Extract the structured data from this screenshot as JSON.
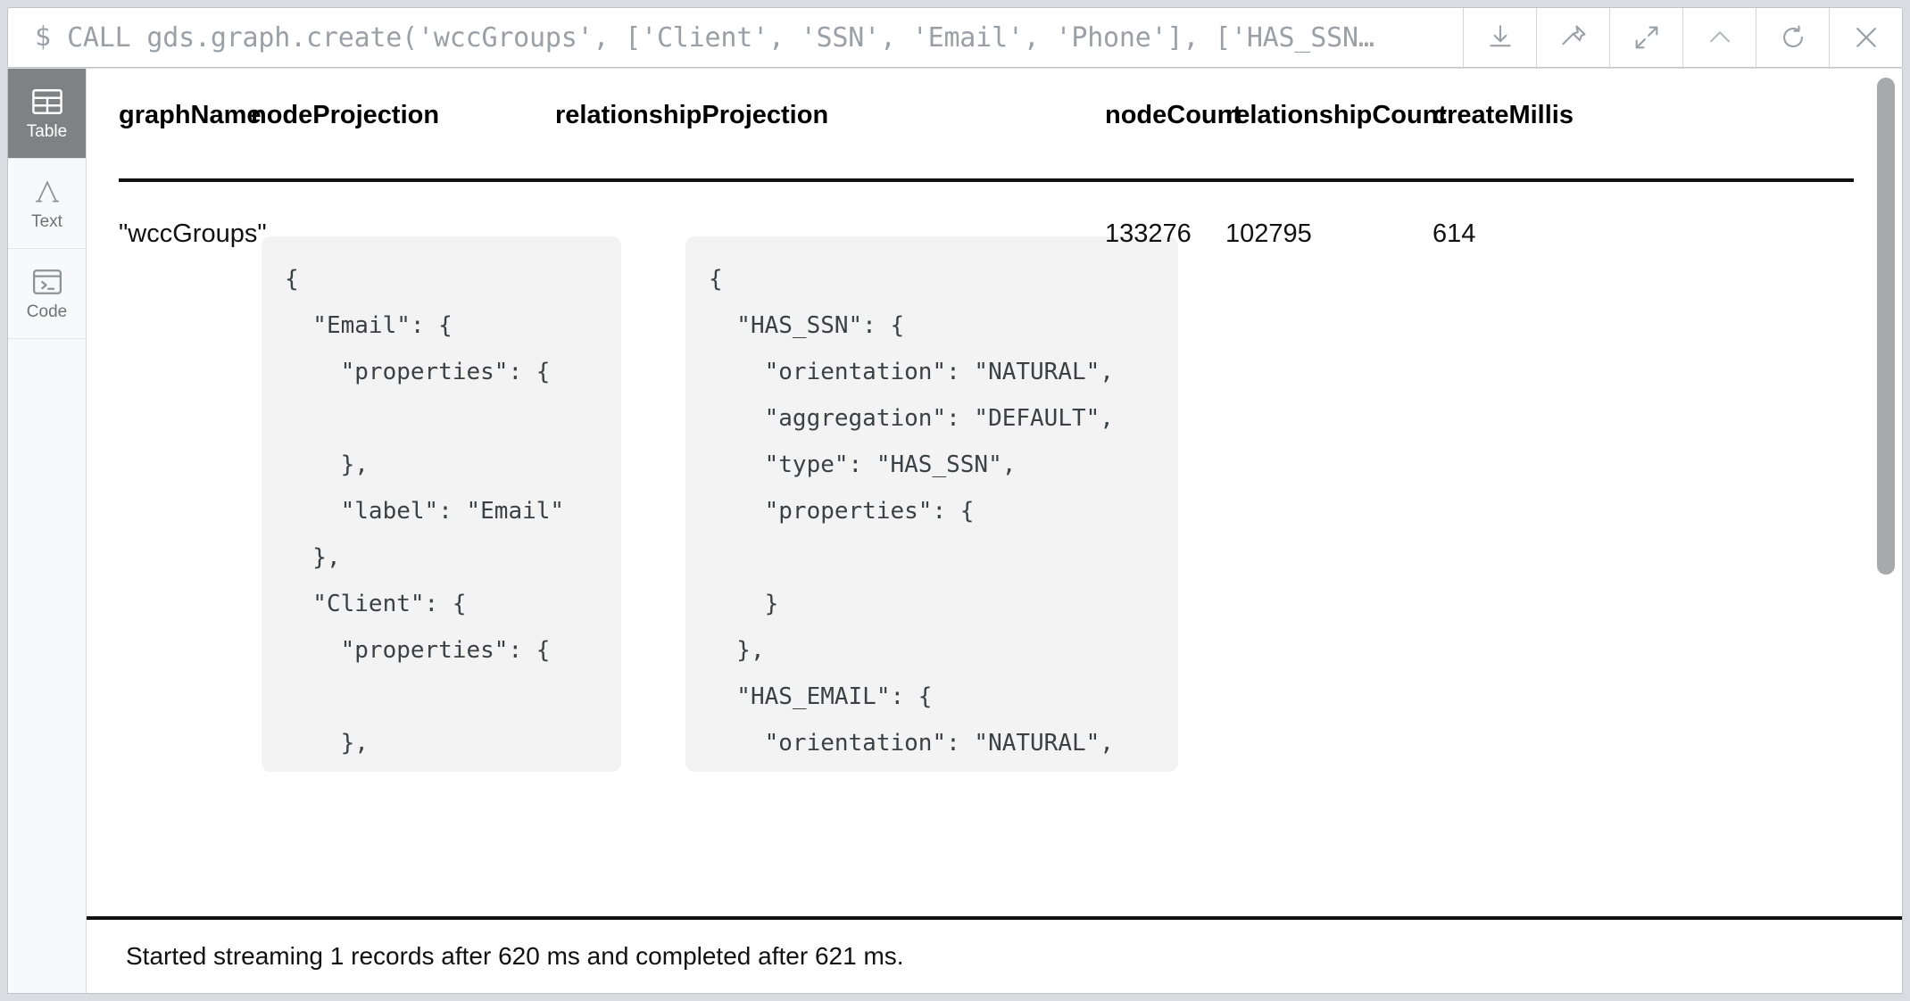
{
  "command_bar": {
    "prompt_symbol": "$",
    "command": "CALL gds.graph.create('wccGroups', ['Client', 'SSN', 'Email', 'Phone'], ['HAS_SSN…",
    "actions": [
      {
        "name": "download-button",
        "icon": "download-icon",
        "label": "Download"
      },
      {
        "name": "pin-button",
        "icon": "pin-icon",
        "label": "Pin"
      },
      {
        "name": "expand-button",
        "icon": "expand-icon",
        "label": "Expand"
      },
      {
        "name": "collapse-button",
        "icon": "chevron-up-icon",
        "label": "Collapse"
      },
      {
        "name": "rerun-button",
        "icon": "refresh-icon",
        "label": "Rerun"
      },
      {
        "name": "close-button",
        "icon": "close-icon",
        "label": "Close"
      }
    ]
  },
  "sidebar": {
    "items": [
      {
        "label": "Table",
        "icon": "table-icon",
        "active": true
      },
      {
        "label": "Text",
        "icon": "text-icon",
        "active": false
      },
      {
        "label": "Code",
        "icon": "code-icon",
        "active": false
      }
    ]
  },
  "table": {
    "columns": [
      "graphName",
      "nodeProjection",
      "relationshipProjection",
      "nodeCount",
      "relationshipCount",
      "createMillis"
    ],
    "row": {
      "graphName": "\"wccGroups\"",
      "nodeProjection": "{\n  \"Email\": {\n    \"properties\": {\n\n    },\n    \"label\": \"Email\"\n  },\n  \"Client\": {\n    \"properties\": {\n\n    },\n    \"label\": \"Client\"\n  },\n  \"Phone\": {\n    \"properties\": {",
      "relationshipProjection": "{\n  \"HAS_SSN\": {\n    \"orientation\": \"NATURAL\",\n    \"aggregation\": \"DEFAULT\",\n    \"type\": \"HAS_SSN\",\n    \"properties\": {\n\n    }\n  },\n  \"HAS_EMAIL\": {\n    \"orientation\": \"NATURAL\",\n    \"aggregation\": \"DEFAULT\",\n    \"type\": \"HAS_EMAIL\",\n    \"properties\": {",
      "nodeCount": "133276",
      "relationshipCount": "102795",
      "createMillis": "614"
    }
  },
  "status": {
    "message": "Started streaming 1 records after 620 ms and completed after 621 ms."
  },
  "colors": {
    "panel_background": "#ffffff",
    "app_background": "#d9dde2",
    "sidebar_background": "#f8f9fa",
    "sidebar_active": "#7f8285",
    "json_block_background": "#f3f3f4",
    "muted_text": "#9aa0a6",
    "scrollbar_thumb": "#a8a9aa"
  }
}
